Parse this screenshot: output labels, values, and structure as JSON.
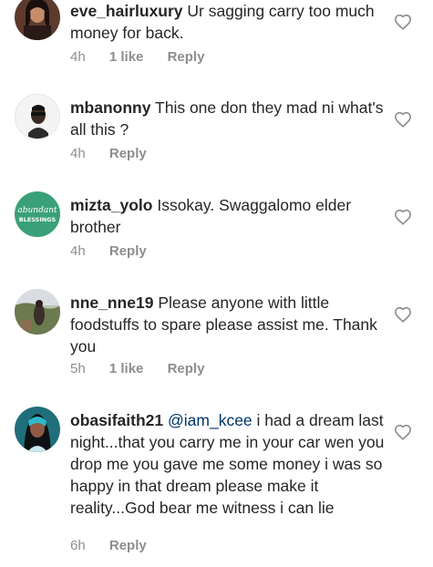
{
  "comments": [
    {
      "username": "eve_hairluxury",
      "text": "Ur sagging carry too much money for back.",
      "time": "4h",
      "likes": "1 like",
      "reply": "Reply",
      "avatar_icon": "avatar-woman-dark-hair"
    },
    {
      "username": "mbanonny",
      "text": "This one don they mad ni what's all this ?",
      "time": "4h",
      "likes": "",
      "reply": "Reply",
      "avatar_icon": "avatar-man-sunglasses"
    },
    {
      "username": "mizta_yolo",
      "text": "Issokay. Swaggalomo elder brother",
      "time": "4h",
      "likes": "",
      "reply": "Reply",
      "avatar_icon": "avatar-abundant-blessings-logo",
      "avatar_logo_text": [
        "abundant",
        "BLESSINGS"
      ]
    },
    {
      "username": "nne_nne19",
      "text": "Please anyone with little foodstuffs to spare please assist me. Thank you",
      "time": "5h",
      "likes": "1 like",
      "reply": "Reply",
      "avatar_icon": "avatar-outdoor-photo"
    },
    {
      "username": "obasifaith21",
      "mention": "@iam_kcee",
      "text": "i had a dream last night...that you carry me in your car wen you drop me you gave me some money i was so happy in that dream please make it reality...God bear me witness i can lie",
      "time": "6h",
      "likes": "",
      "reply": "Reply",
      "avatar_icon": "avatar-woman-teal"
    }
  ],
  "colors": {
    "username": "#262626",
    "meta": "#8e8e8e",
    "mention": "#003569",
    "heart_outline": "#8e8e8e"
  }
}
